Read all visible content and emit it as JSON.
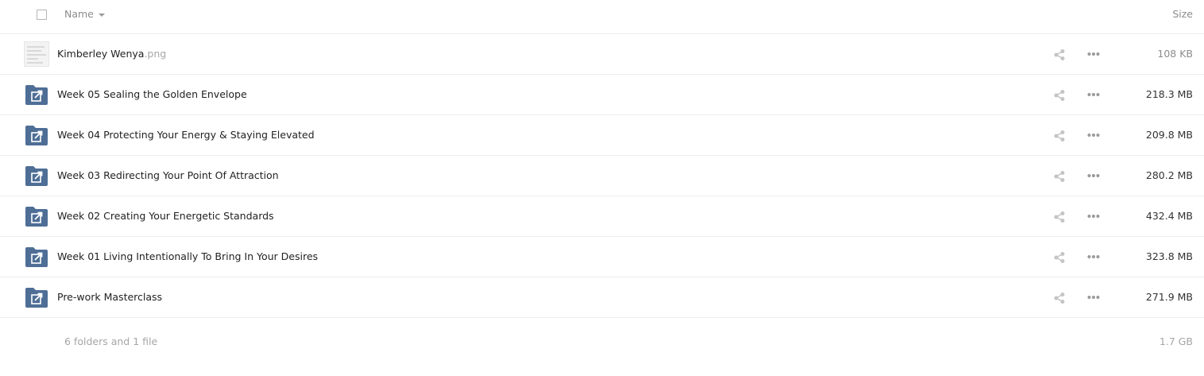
{
  "header": {
    "name_label": "Name",
    "size_label": "Size",
    "sort_icon": "caret-down-icon"
  },
  "rows": [
    {
      "type": "file",
      "name": "Kimberley Wenya",
      "ext": ".png",
      "size": "108 KB"
    },
    {
      "type": "shared-folder",
      "name": "Week 05 Sealing the Golden Envelope",
      "ext": "",
      "size": "218.3 MB"
    },
    {
      "type": "shared-folder",
      "name": "Week 04 Protecting Your Energy & Staying Elevated",
      "ext": "",
      "size": "209.8 MB"
    },
    {
      "type": "shared-folder",
      "name": "Week 03 Redirecting Your Point Of Attraction",
      "ext": "",
      "size": "280.2 MB"
    },
    {
      "type": "shared-folder",
      "name": "Week 02 Creating Your Energetic Standards",
      "ext": "",
      "size": "432.4 MB"
    },
    {
      "type": "shared-folder",
      "name": "Week 01 Living Intentionally To Bring In Your Desires",
      "ext": "",
      "size": "323.8 MB"
    },
    {
      "type": "shared-folder",
      "name": "Pre-work Masterclass",
      "ext": "",
      "size": "271.9 MB"
    }
  ],
  "footer": {
    "summary": "6 folders and 1 file",
    "total_size": "1.7 GB"
  },
  "colors": {
    "folder": "#4e6e96",
    "action_icon": "#c4c4c4",
    "divider": "#ededed"
  }
}
